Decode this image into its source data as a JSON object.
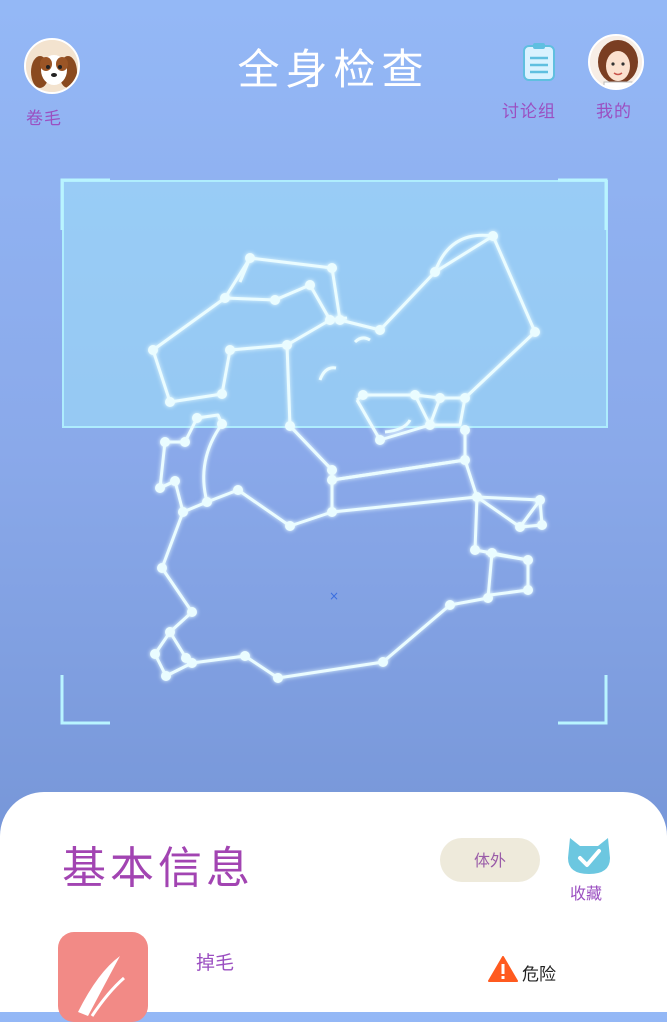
{
  "header": {
    "title": "全身检查",
    "pet_label": "卷毛",
    "discuss_label": "讨论组",
    "me_label": "我的"
  },
  "card": {
    "section_title": "基本信息",
    "external_button": "体外",
    "favorite_label": "收藏",
    "item_name": "掉毛",
    "risk_label": "危险"
  },
  "icons": {
    "pet_avatar": "dog-avatar",
    "me_avatar": "user-avatar",
    "discuss": "clipboard-icon",
    "favorite": "cat-check-icon",
    "warning": "warning-icon"
  },
  "colors": {
    "accent": "#9b4fc1",
    "scan_box": "#a0e1fa",
    "danger": "#ff5a1f",
    "item_tile": "#f28a86"
  }
}
